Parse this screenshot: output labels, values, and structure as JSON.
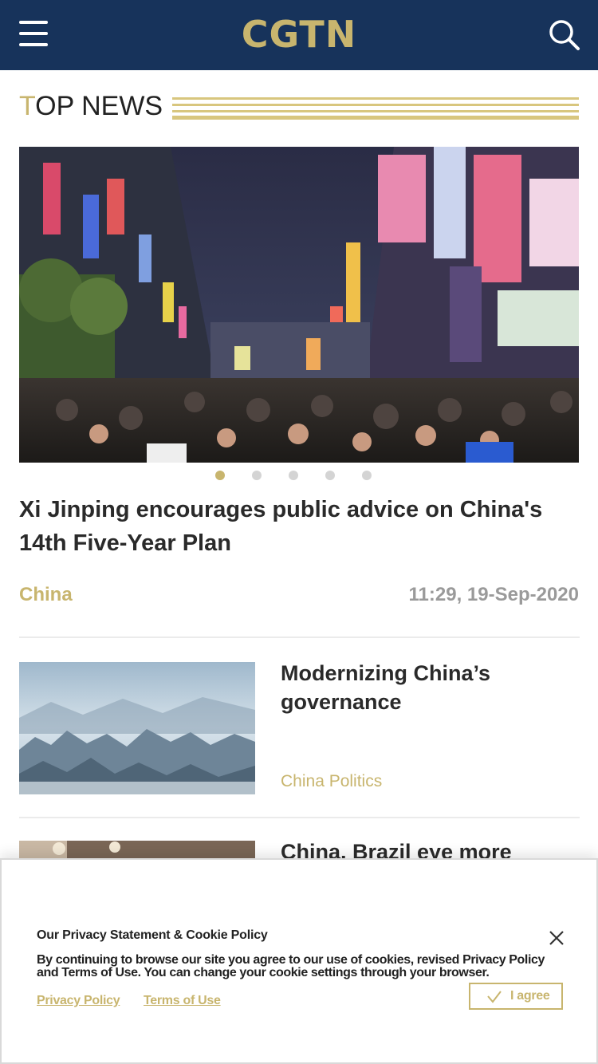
{
  "header": {
    "logo": "CGTN",
    "menu_icon": "hamburger-menu-icon",
    "search_icon": "search-icon",
    "background": "#17335b",
    "accent": "#c8b56e"
  },
  "section": {
    "title_first": "T",
    "title_rest": "OP NEWS"
  },
  "carousel": {
    "slide_count": 5,
    "active_index": 0
  },
  "top_story": {
    "headline": "Xi Jinping encourages public advice on China's 14th Five-Year Plan",
    "category": "China",
    "timestamp": "11:29, 19-Sep-2020"
  },
  "stories": [
    {
      "title": "Modernizing China’s governance",
      "category": "China Politics"
    },
    {
      "title": "China, Brazil eye more",
      "category": ""
    }
  ],
  "cookie_banner": {
    "title": "Our Privacy Statement & Cookie Policy",
    "text": "By continuing to browse our site you agree to our use of cookies, revised Privacy Policy and Terms of Use. You can change your cookie settings through your browser.",
    "privacy_link": "Privacy Policy",
    "terms_link": "Terms of Use",
    "agree_label": "I agree",
    "close_icon": "close-icon",
    "check_icon": "checkmark-icon"
  }
}
